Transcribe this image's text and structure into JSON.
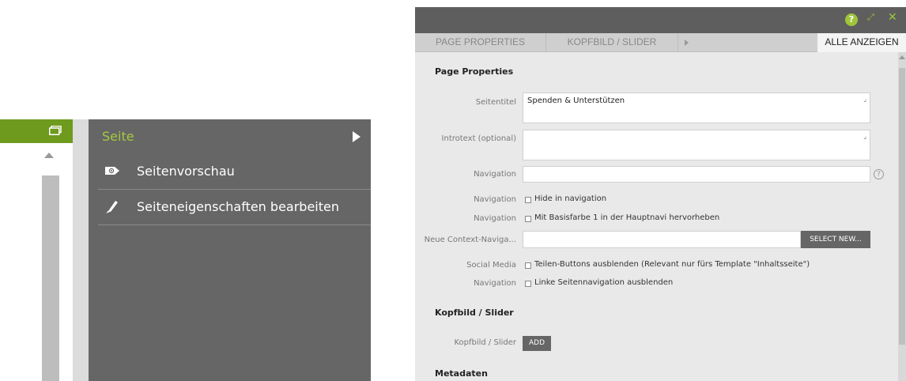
{
  "menu": {
    "title": "Seite",
    "items": [
      {
        "label": "Seitenvorschau",
        "icon": "eye-tag-icon"
      },
      {
        "label": "Seiteneigenschaften bearbeiten",
        "icon": "pencil-icon"
      }
    ]
  },
  "dialog": {
    "help_icon_text": "?",
    "tabs": [
      "PAGE PROPERTIES",
      "KOPFBILD / SLIDER",
      "ALLE ANZEIGEN"
    ],
    "sections": {
      "page_properties": "Page Properties",
      "kopfbild": "Kopfbild / Slider",
      "metadaten": "Metadaten"
    },
    "fields": {
      "seitentitel": {
        "label": "Seitentitel",
        "value": "Spenden & Unterstützen"
      },
      "introtext": {
        "label": "Introtext (optional)",
        "value": ""
      },
      "navigation": {
        "label": "Navigation",
        "value": ""
      },
      "hide_nav": {
        "label": "Navigation",
        "text": "Hide in navigation"
      },
      "highlight": {
        "label": "Navigation",
        "text": "Mit Basisfarbe 1 in der Hauptnavi hervorheben"
      },
      "context_nav": {
        "label": "Neue Context-Naviga...",
        "button": "SELECT NEW..."
      },
      "social": {
        "label": "Social Media",
        "text": "Teilen-Buttons ausblenden (Relevant nur fürs Template \"Inhaltsseite\")"
      },
      "left_nav": {
        "label": "Navigation",
        "text": "Linke Seitennavigation ausblenden"
      },
      "kopfbild_field": {
        "label": "Kopfbild / Slider",
        "button": "ADD"
      }
    }
  },
  "colors": {
    "accent_green": "#6e9a1e",
    "menu_bg": "#666666",
    "menu_title": "#a5c93e"
  }
}
